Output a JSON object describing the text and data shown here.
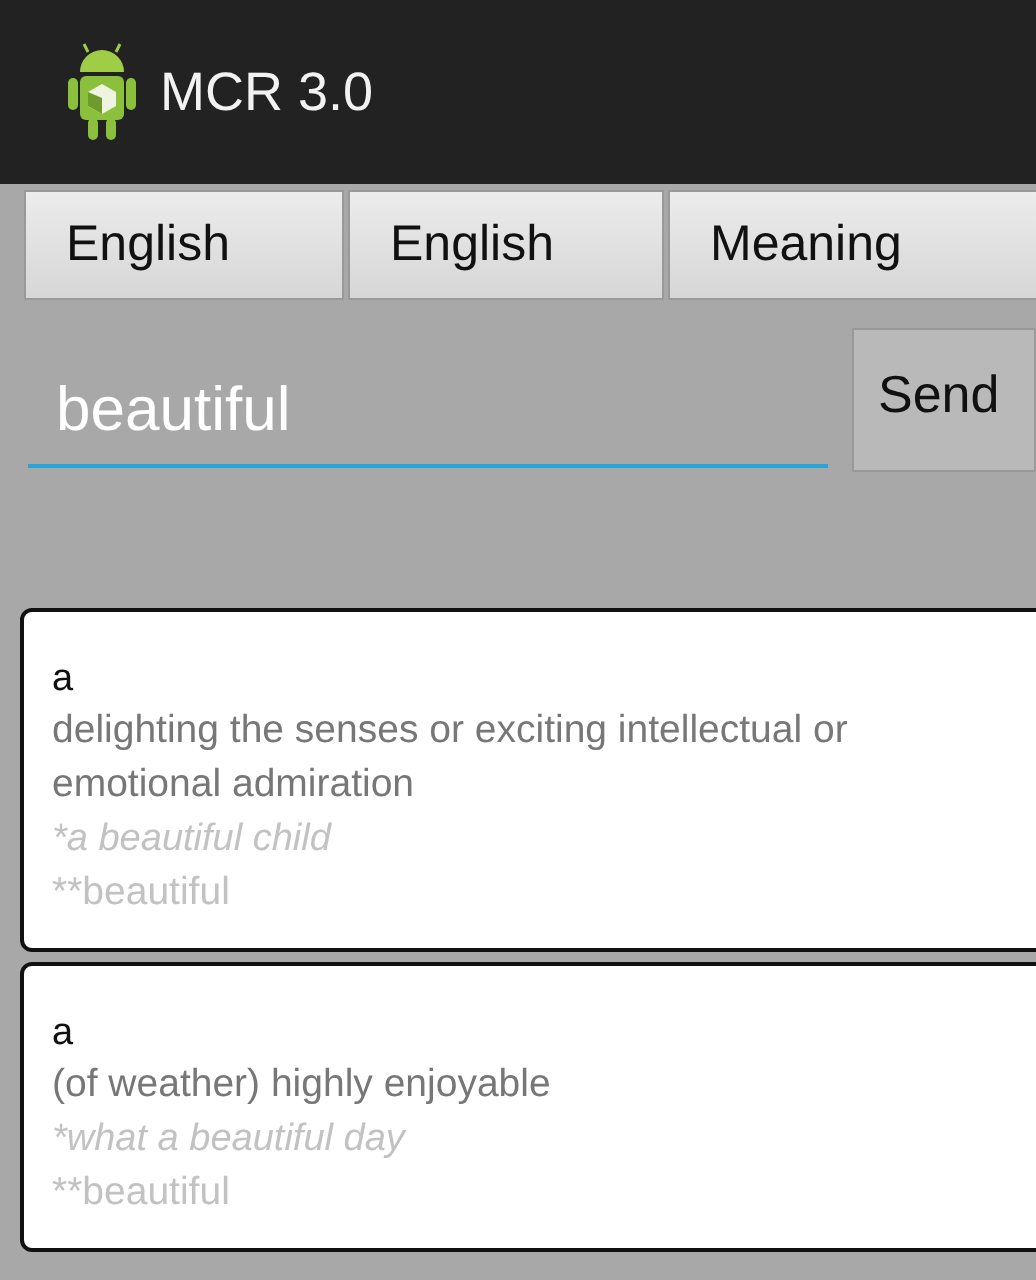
{
  "app_bar": {
    "title": "MCR 3.0"
  },
  "language_buttons": [
    {
      "label": "English"
    },
    {
      "label": "English"
    },
    {
      "label": "Meaning"
    }
  ],
  "search": {
    "value": "beautiful",
    "send_label": "Send"
  },
  "results": [
    {
      "part_of_speech": "a",
      "definition": "delighting the senses or exciting intellectual or emotional admiration",
      "example": "*a beautiful child",
      "word": "**beautiful"
    },
    {
      "part_of_speech": "a",
      "definition": "(of weather) highly enjoyable",
      "example": "*what a beautiful day",
      "word": "**beautiful"
    }
  ]
}
